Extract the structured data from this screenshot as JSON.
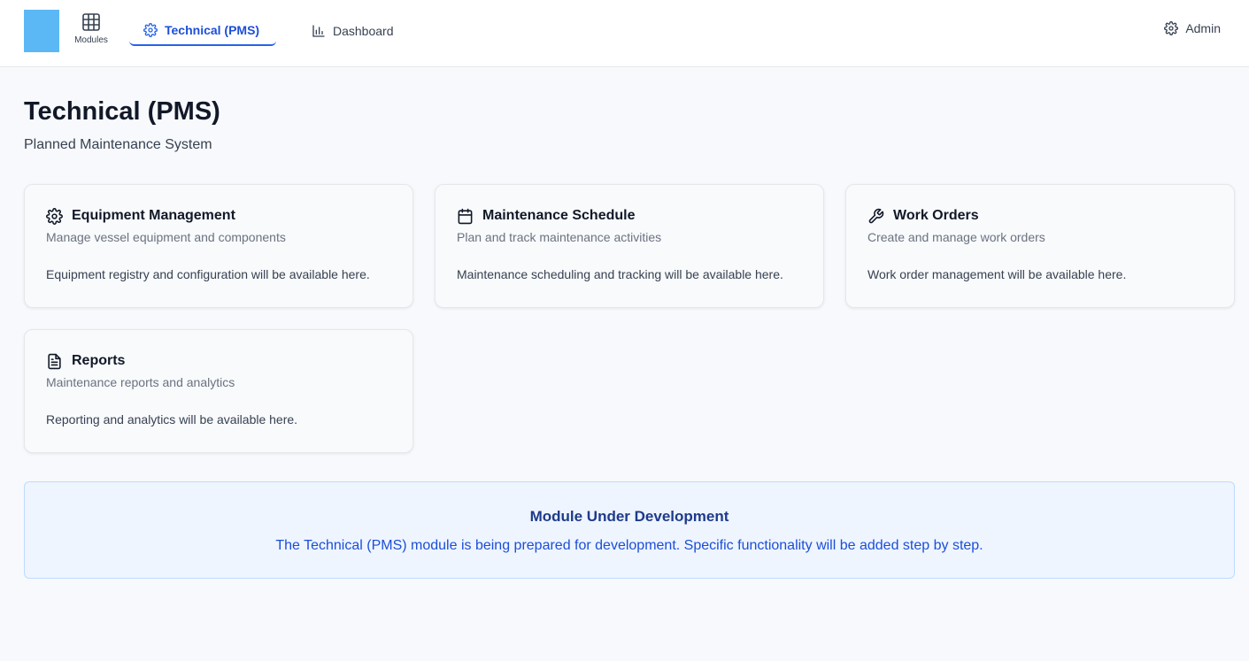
{
  "colors": {
    "brand": "#5bb8f5",
    "accent": "#2563eb",
    "notice_bg": "#eef5ff"
  },
  "header": {
    "modules_label": "Modules",
    "tabs": [
      {
        "label": "Technical (PMS)",
        "icon": "gear-icon",
        "active": true
      },
      {
        "label": "Dashboard",
        "icon": "bar-chart-icon",
        "active": false
      }
    ],
    "user_label": "Admin"
  },
  "page": {
    "title": "Technical (PMS)",
    "subtitle": "Planned Maintenance System"
  },
  "cards": [
    {
      "icon": "gear-icon",
      "title": "Equipment Management",
      "description": "Manage vessel equipment and components",
      "body": "Equipment registry and configuration will be available here."
    },
    {
      "icon": "calendar-icon",
      "title": "Maintenance Schedule",
      "description": "Plan and track maintenance activities",
      "body": "Maintenance scheduling and tracking will be available here."
    },
    {
      "icon": "wrench-icon",
      "title": "Work Orders",
      "description": "Create and manage work orders",
      "body": "Work order management will be available here."
    },
    {
      "icon": "document-icon",
      "title": "Reports",
      "description": "Maintenance reports and analytics",
      "body": "Reporting and analytics will be available here."
    }
  ],
  "notice": {
    "title": "Module Under Development",
    "text": "The Technical (PMS) module is being prepared for development. Specific functionality will be added step by step."
  }
}
